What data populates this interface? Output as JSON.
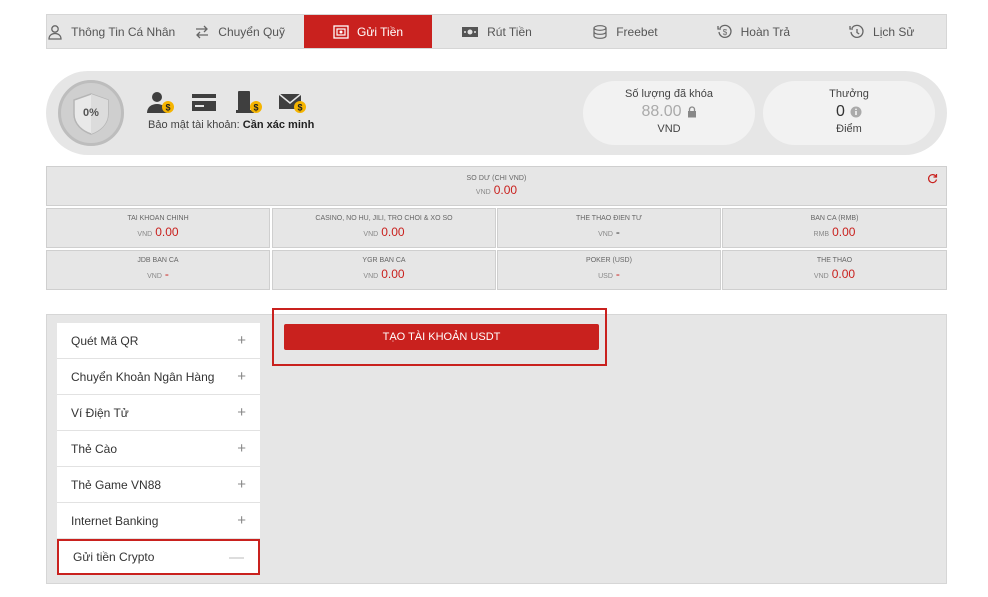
{
  "nav": {
    "items": [
      {
        "label": "Thông Tin Cá Nhân",
        "icon": "user-icon"
      },
      {
        "label": "Chuyển Quỹ",
        "icon": "transfer-icon"
      },
      {
        "label": "Gửi Tiền",
        "icon": "deposit-icon"
      },
      {
        "label": "Rút Tiền",
        "icon": "withdraw-icon"
      },
      {
        "label": "Freebet",
        "icon": "coins-icon"
      },
      {
        "label": "Hoàn Trả",
        "icon": "refund-icon"
      },
      {
        "label": "Lịch Sử",
        "icon": "history-icon"
      }
    ],
    "active_index": 2,
    "active_color": "#c9211e"
  },
  "security": {
    "percent": "0%",
    "label": "Bảo mật tài khoản:",
    "status": "Cần xác minh",
    "icons": [
      "user-verify-icon",
      "card-icon",
      "phone-verify-icon",
      "email-verify-icon"
    ]
  },
  "locked": {
    "label": "Số lượng đã khóa",
    "value": "88.00",
    "unit": "VND"
  },
  "bonus": {
    "label": "Thưởng",
    "value": "0",
    "unit": "Điểm"
  },
  "balance": {
    "label": "SO DƯ (CHI VND)",
    "currency": "VND",
    "value": "0.00",
    "cells": [
      {
        "label": "TAI KHOAN CHINH",
        "currency": "VND",
        "value": "0.00"
      },
      {
        "label": "CASINO, NO HU, JILI, TRO CHOI & XO SO",
        "currency": "VND",
        "value": "0.00"
      },
      {
        "label": "THE THAO ĐIEN TƯ",
        "currency": "VND",
        "value": "-"
      },
      {
        "label": "BAN CA (RMB)",
        "currency": "RMB",
        "value": "0.00"
      },
      {
        "label": "JDB BAN CA",
        "currency": "VND",
        "value": "-"
      },
      {
        "label": "YGR BAN CA",
        "currency": "VND",
        "value": "0.00"
      },
      {
        "label": "POKER (USD)",
        "currency": "USD",
        "value": "-"
      },
      {
        "label": "THE THAO",
        "currency": "VND",
        "value": "0.00"
      }
    ]
  },
  "deposit_menu": {
    "items": [
      {
        "label": "Quét Mã QR",
        "toggle": "+"
      },
      {
        "label": "Chuyển Khoản Ngân Hàng",
        "toggle": "+"
      },
      {
        "label": "Ví Điện Tử",
        "toggle": "+"
      },
      {
        "label": "Thẻ Cào",
        "toggle": "+"
      },
      {
        "label": "Thẻ Game VN88",
        "toggle": "+"
      },
      {
        "label": "Internet Banking",
        "toggle": "+"
      },
      {
        "label": "Gửi tiền Crypto",
        "toggle": "—"
      }
    ],
    "open_index": 6
  },
  "usdt_button": {
    "label": "TẠO TÀI KHOẢN USDT"
  }
}
